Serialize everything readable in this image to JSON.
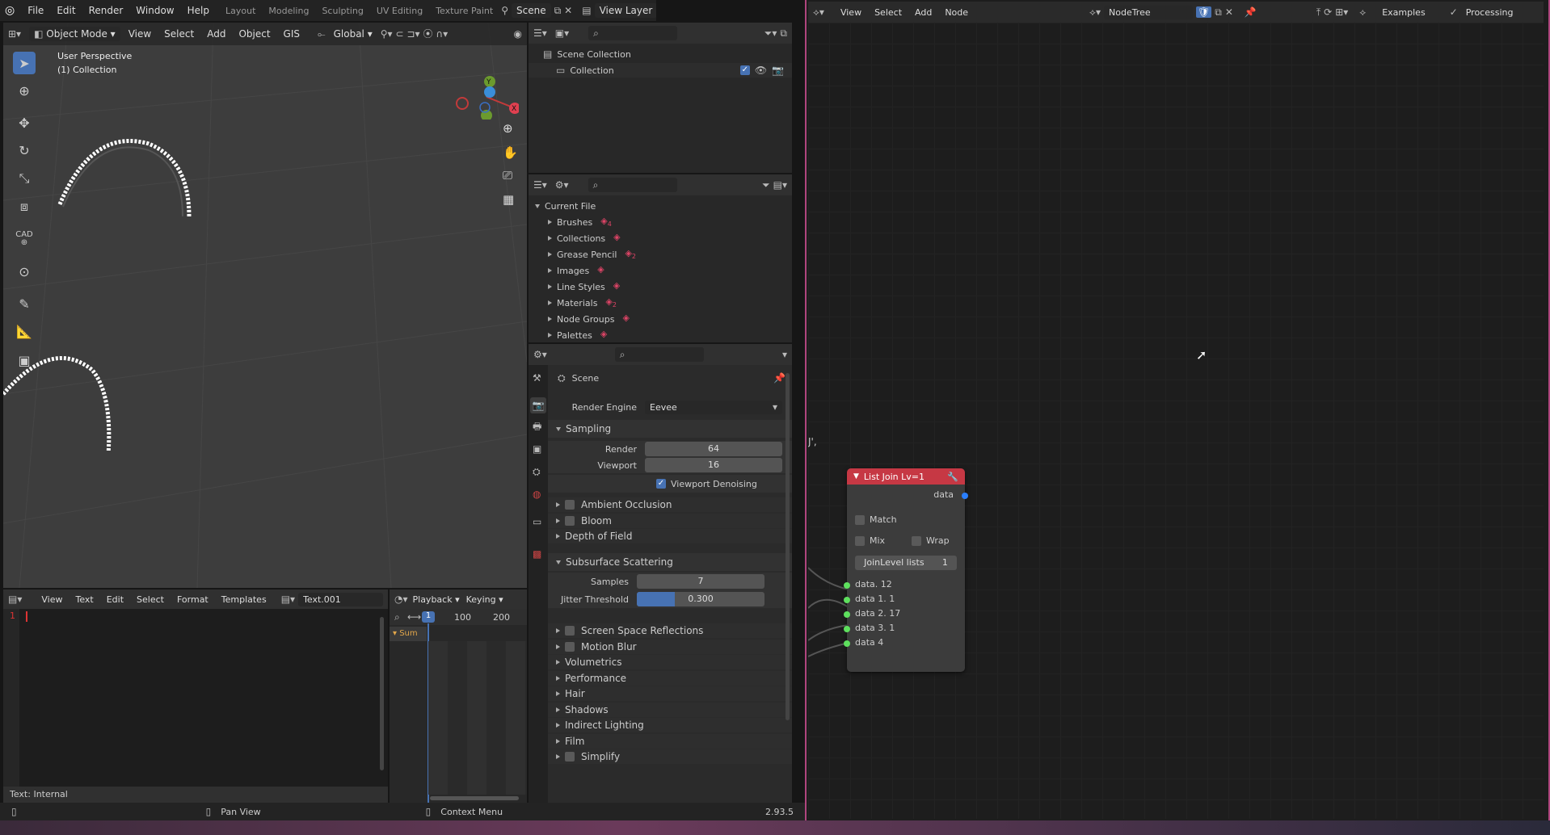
{
  "topbar": {
    "menus": [
      "File",
      "Edit",
      "Render",
      "Window",
      "Help"
    ],
    "workspaces": [
      "Layout",
      "Modeling",
      "Sculpting",
      "UV Editing",
      "Texture Paint"
    ],
    "scene": "Scene",
    "view_layer": "View Layer"
  },
  "viewport": {
    "mode": "Object Mode",
    "menus": [
      "View",
      "Select",
      "Add",
      "Object",
      "GIS"
    ],
    "orientation": "Global",
    "perspective_label": "User Perspective",
    "collection_label": "(1) Collection",
    "tools": [
      "select-box-icon",
      "cursor-icon",
      "move-icon",
      "rotate-icon",
      "scale-icon",
      "transform-icon",
      "cad-icon",
      "cad-extra-icon",
      "annotate-icon",
      "measure-icon",
      "add-cube-icon"
    ],
    "tool_cad_text": "CAD",
    "gizmo_axes": [
      "Y",
      "X"
    ]
  },
  "outliner": {
    "scene_collection": "Scene Collection",
    "collection": "Collection"
  },
  "blend_browser": {
    "root": "Current File",
    "items": [
      {
        "label": "Brushes",
        "badge": "4"
      },
      {
        "label": "Collections",
        "badge": ""
      },
      {
        "label": "Grease Pencil",
        "badge": "2"
      },
      {
        "label": "Images",
        "badge": ""
      },
      {
        "label": "Line Styles",
        "badge": ""
      },
      {
        "label": "Materials",
        "badge": "2"
      },
      {
        "label": "Node Groups",
        "badge": ""
      },
      {
        "label": "Palettes",
        "badge": ""
      }
    ]
  },
  "properties": {
    "context": "Scene",
    "render_engine_label": "Render Engine",
    "render_engine": "Eevee",
    "sampling": {
      "title": "Sampling",
      "render_label": "Render",
      "render_value": "64",
      "viewport_label": "Viewport",
      "viewport_value": "16",
      "denoise_label": "Viewport Denoising"
    },
    "panels_before": [
      {
        "label": "Ambient Occlusion",
        "checkbox": true
      },
      {
        "label": "Bloom",
        "checkbox": true
      },
      {
        "label": "Depth of Field",
        "checkbox": false
      }
    ],
    "sss": {
      "title": "Subsurface Scattering",
      "samples_label": "Samples",
      "samples_value": "7",
      "jitter_label": "Jitter Threshold",
      "jitter_value": "0.300",
      "jitter_fraction": 0.3
    },
    "panels_after": [
      {
        "label": "Screen Space Reflections",
        "checkbox": true
      },
      {
        "label": "Motion Blur",
        "checkbox": true
      },
      {
        "label": "Volumetrics",
        "checkbox": false
      },
      {
        "label": "Performance",
        "checkbox": false
      },
      {
        "label": "Hair",
        "checkbox": false
      },
      {
        "label": "Shadows",
        "checkbox": false
      },
      {
        "label": "Indirect Lighting",
        "checkbox": false
      },
      {
        "label": "Film",
        "checkbox": false
      },
      {
        "label": "Simplify",
        "checkbox": true
      }
    ]
  },
  "text_editor": {
    "menus": [
      "View",
      "Text",
      "Edit",
      "Select",
      "Format",
      "Templates"
    ],
    "file": "Text.001",
    "line_no": "1",
    "status": "Text: Internal"
  },
  "timeline": {
    "menus": [
      "Playback",
      "Keying"
    ],
    "frame": "1",
    "ticks": [
      "100",
      "200"
    ],
    "summary": "Sum"
  },
  "node_editor": {
    "menus": [
      "View",
      "Select",
      "Add",
      "Node"
    ],
    "tree": "NodeTree",
    "examples": "Examples",
    "processing": "Processing",
    "edge_text": "J',",
    "node": {
      "title": "List Join Lv=1",
      "output": "data",
      "match": "Match",
      "mix": "Mix",
      "wrap": "Wrap",
      "join_label": "JoinLevel lists",
      "join_value": "1",
      "inputs": [
        "data. 12",
        "data 1. 1",
        "data 2. 17",
        "data 3. 1",
        "data 4"
      ]
    },
    "colors": {
      "node_header": "#c63844",
      "socket_out": "#2a7fff",
      "socket_in": "#5ee05e"
    }
  },
  "statusbar": {
    "pan_view": "Pan View",
    "context_menu": "Context Menu",
    "version": "2.93.5"
  }
}
